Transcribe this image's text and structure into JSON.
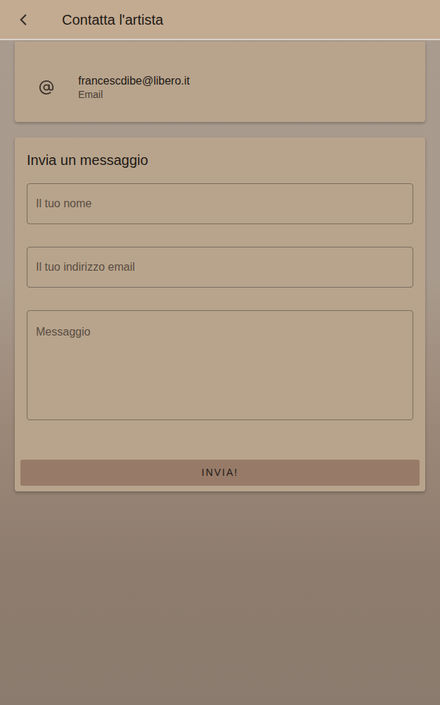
{
  "header": {
    "title": "Contatta l'artista"
  },
  "contact": {
    "value": "francescdibe@libero.it",
    "label": "Email"
  },
  "form": {
    "title": "Invia un messaggio",
    "fields": [
      {
        "placeholder": "Il tuo nome",
        "kind": "input"
      },
      {
        "placeholder": "Il tuo indirizzo email",
        "kind": "input"
      },
      {
        "placeholder": "Messaggio",
        "kind": "textarea"
      }
    ],
    "submit": "INVIA!"
  }
}
